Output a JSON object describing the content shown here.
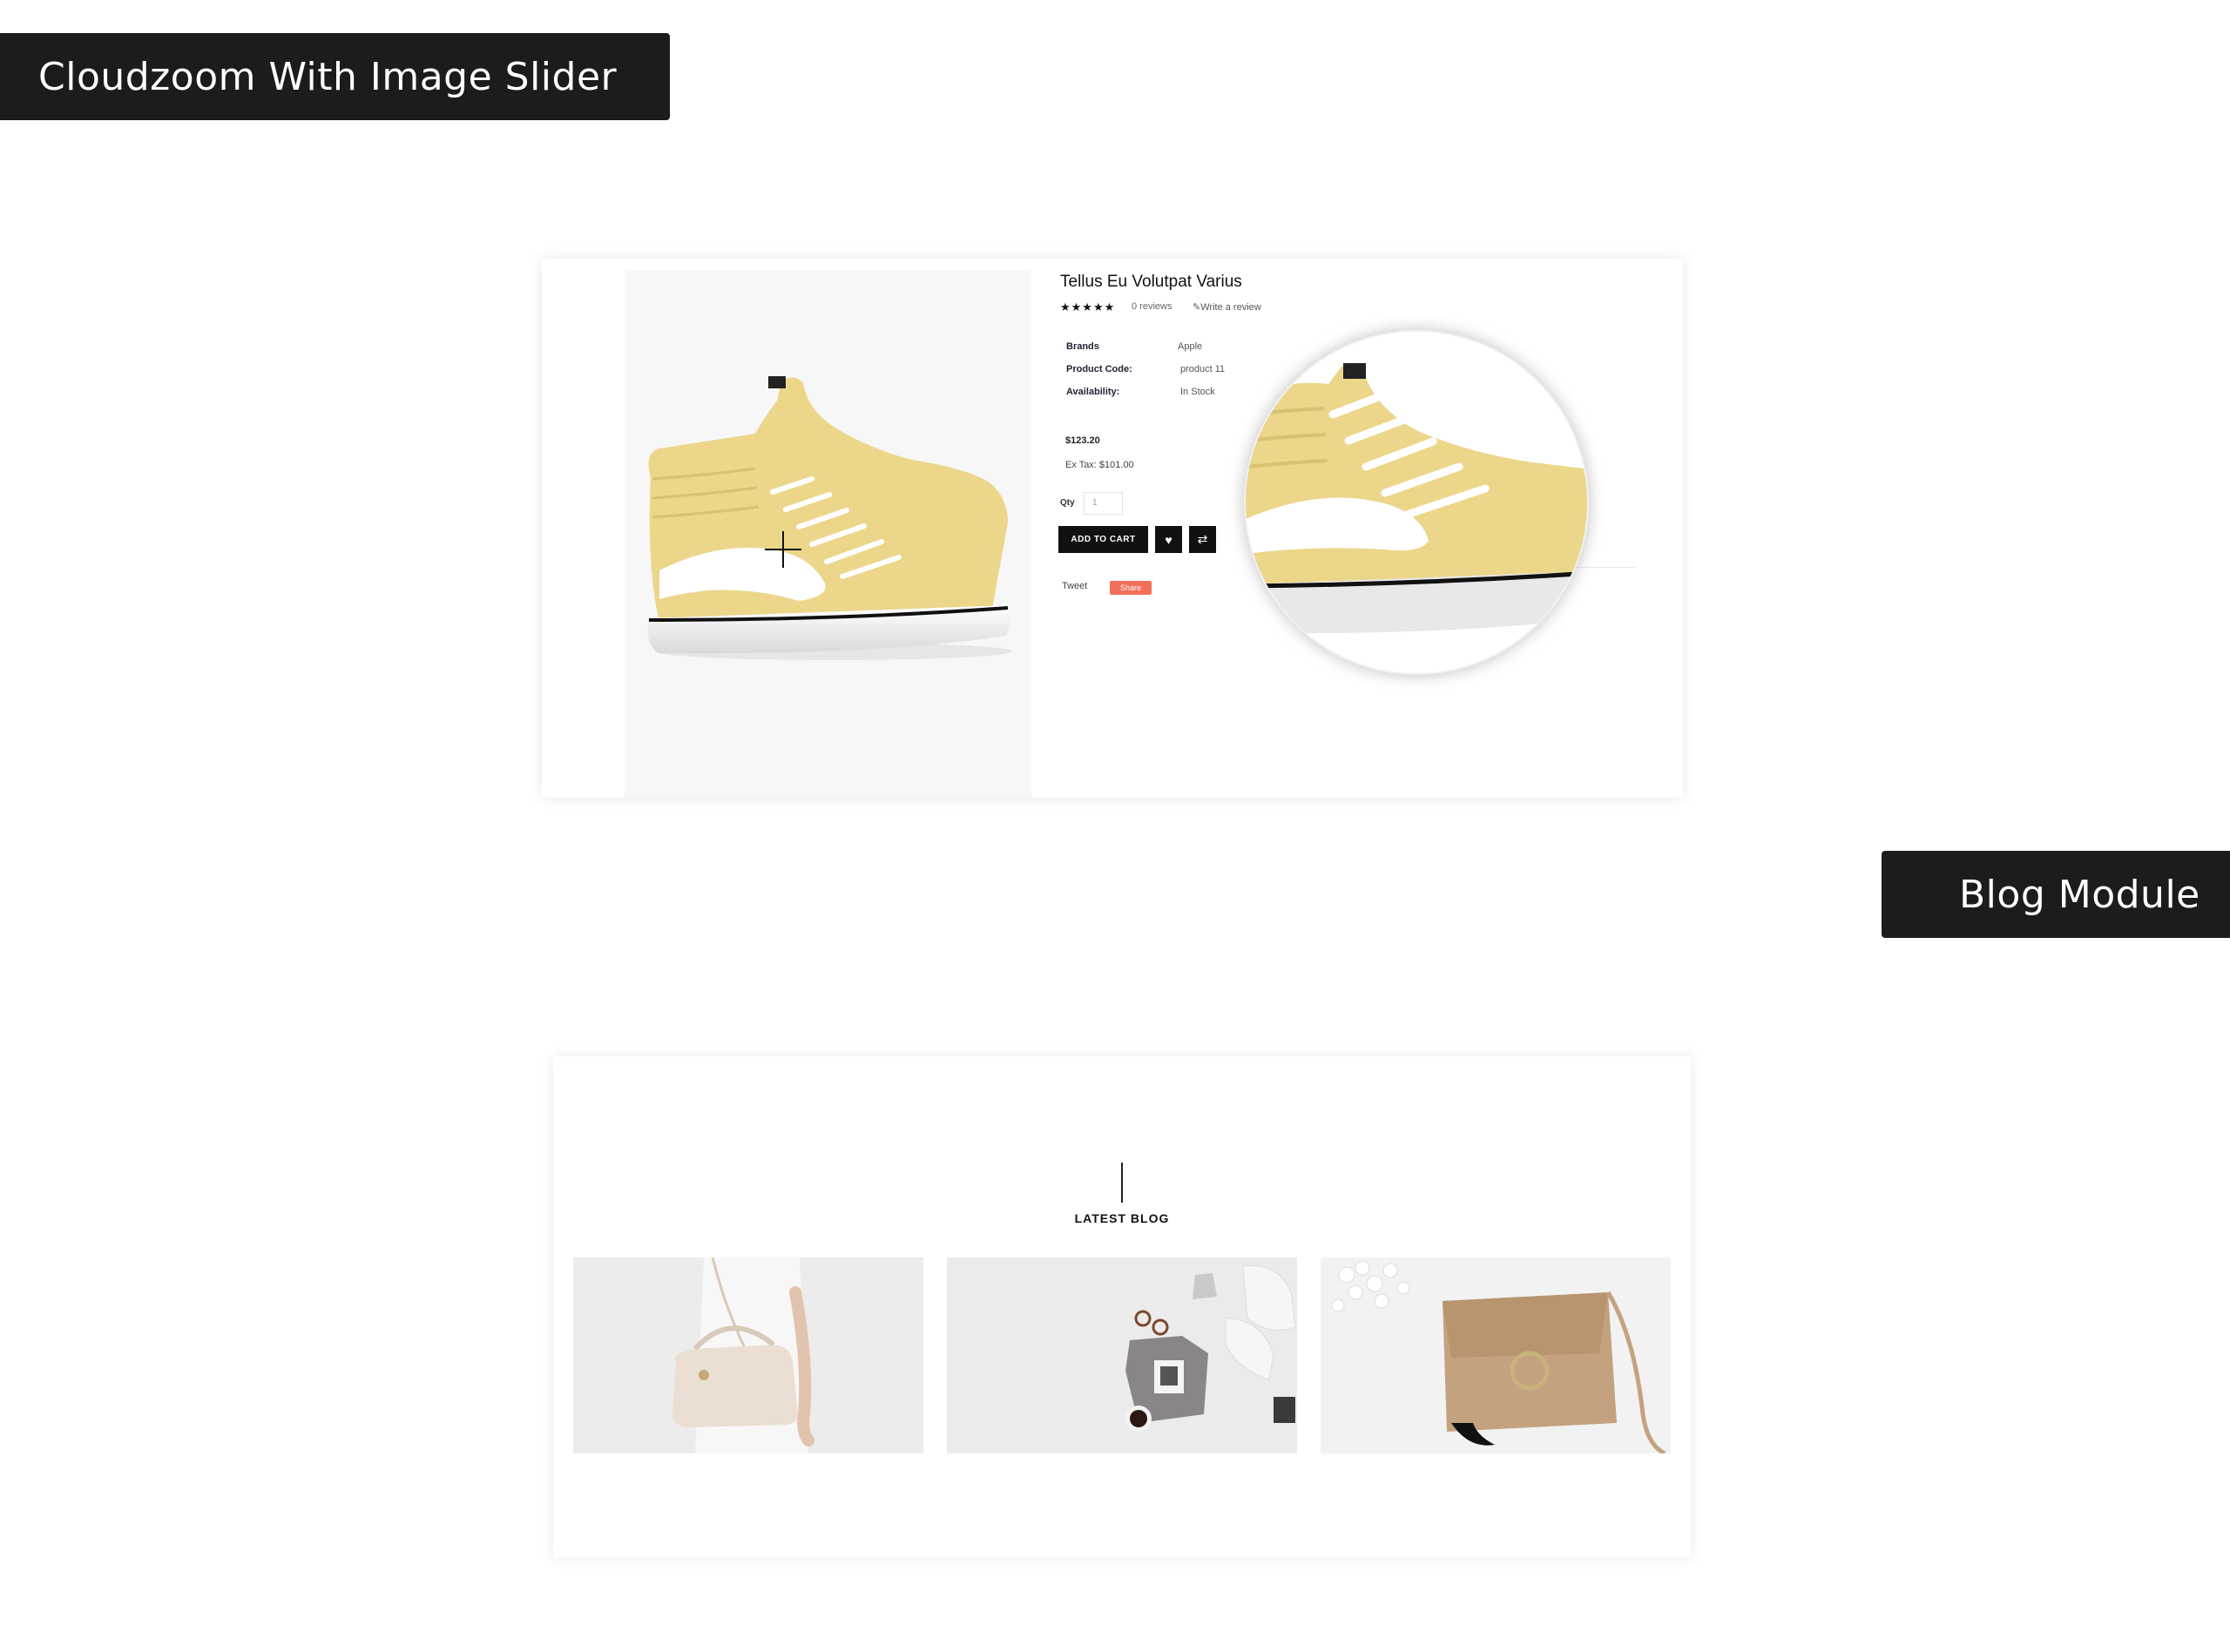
{
  "banners": {
    "cloudzoom": "Cloudzoom With Image Slider",
    "blog": "Blog Module"
  },
  "product": {
    "title": "Tellus Eu Volutpat Varius",
    "rating_stars": "★★★★★",
    "reviews": "0 reviews",
    "write_review": "✎Write a review",
    "specs": [
      {
        "label": "Brands",
        "value": "Apple"
      },
      {
        "label": "Product Code:",
        "value": "product 11"
      },
      {
        "label": "Availability:",
        "value": "In Stock"
      }
    ],
    "price": "$123.20",
    "ex_tax": "Ex Tax: $101.00",
    "qty_label": "Qty",
    "qty_value": "1",
    "add_to_cart": "ADD TO CART",
    "wishlist_icon": "heart-icon",
    "compare_icon": "compare-icon",
    "tweet": "Tweet",
    "share": "Share"
  },
  "blog": {
    "heading": "LATEST BLOG",
    "cards": [
      {
        "image": "woman-with-handbag"
      },
      {
        "image": "flatlay-sweater-sneakers"
      },
      {
        "image": "suede-crossbody-bag"
      }
    ]
  },
  "colors": {
    "banner_bg": "#1c1c1c",
    "share_bg": "#f2705a",
    "shoe_yellow": "#ecd68a"
  }
}
